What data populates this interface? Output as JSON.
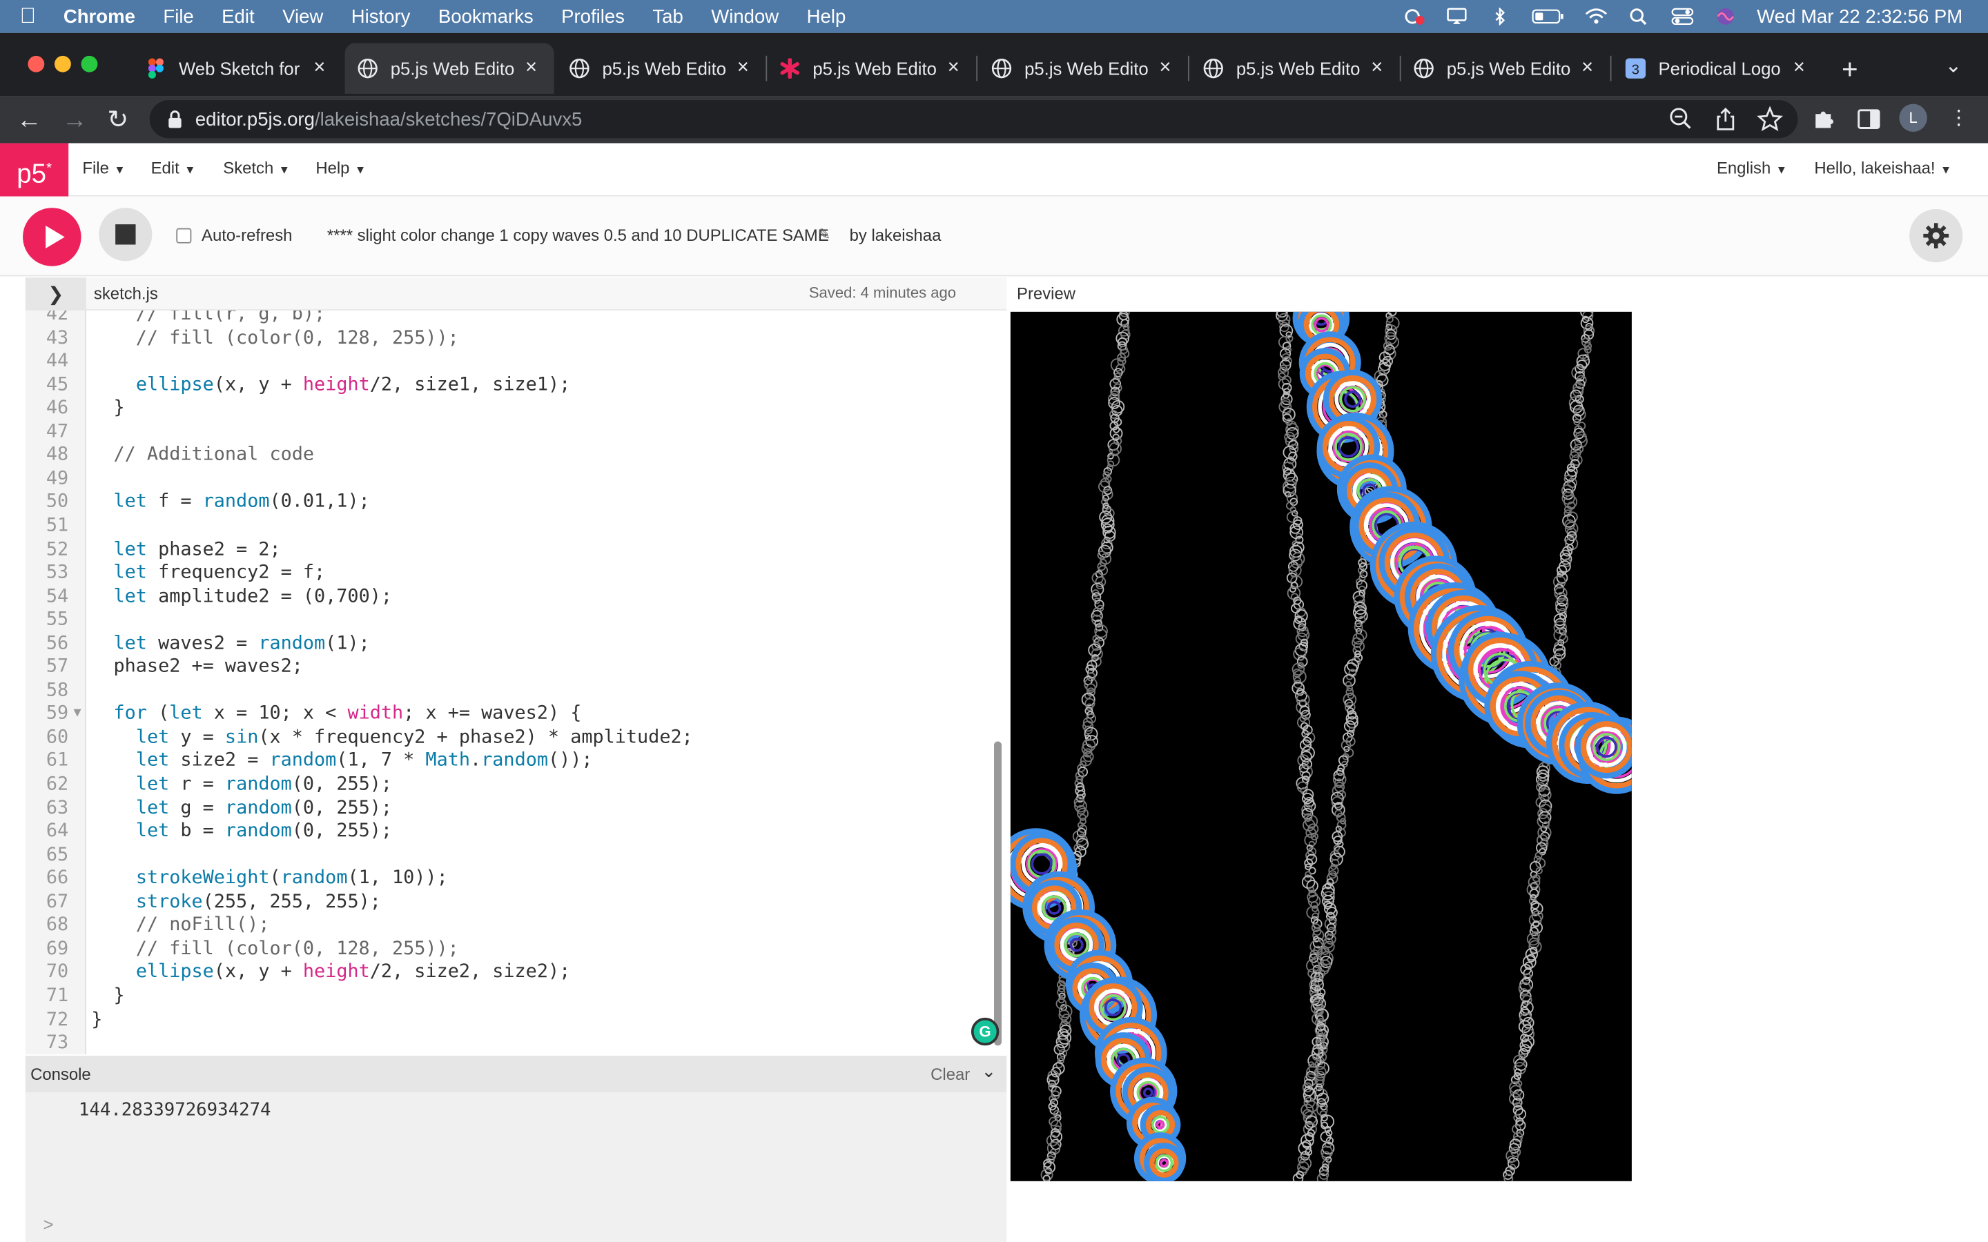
{
  "menubar": {
    "items": [
      "Chrome",
      "File",
      "Edit",
      "View",
      "History",
      "Bookmarks",
      "Profiles",
      "Tab",
      "Window",
      "Help"
    ],
    "clock": "Wed Mar 22  2:32:56 PM"
  },
  "tabs": [
    {
      "title": "Web Sketch for",
      "icon": "figma-icon"
    },
    {
      "title": "p5.js Web Edito",
      "icon": "globe-icon",
      "active": true
    },
    {
      "title": "p5.js Web Edito",
      "icon": "globe-icon"
    },
    {
      "title": "p5.js Web Edito",
      "icon": "asterisk-icon"
    },
    {
      "title": "p5.js Web Edito",
      "icon": "globe-icon"
    },
    {
      "title": "p5.js Web Edito",
      "icon": "globe-icon"
    },
    {
      "title": "p5.js Web Edito",
      "icon": "globe-icon"
    },
    {
      "title": "Periodical Logo",
      "icon": "number-3-icon"
    }
  ],
  "address": {
    "host": "editor.p5js.org",
    "path": "/lakeishaa/sketches/7QiDAuvx5"
  },
  "profile_initial": "L",
  "nav": {
    "logo": "p5",
    "logo_sup": "*",
    "menus": [
      "File",
      "Edit",
      "Sketch",
      "Help"
    ],
    "language": "English",
    "greeting": "Hello, lakeishaa!"
  },
  "toolbar": {
    "auto_refresh_label": "Auto-refresh",
    "sketch_name": "**** slight color change 1 copy waves 0.5 and 10 DUPLICATE SAME",
    "by_prefix": "by ",
    "author": "lakeishaa"
  },
  "filebar": {
    "filename": "sketch.js",
    "saved": "Saved: 4 minutes ago",
    "preview_label": "Preview"
  },
  "code_lines": [
    {
      "n": "42",
      "t": "    // fill(r, g, b);"
    },
    {
      "n": "43",
      "t": "    // fill (color(0, 128, 255));"
    },
    {
      "n": "44",
      "t": ""
    },
    {
      "n": "45",
      "t": "    ellipse(x, y + height/2, size1, size1);"
    },
    {
      "n": "46",
      "t": "  }"
    },
    {
      "n": "47",
      "t": ""
    },
    {
      "n": "48",
      "t": "  // Additional code"
    },
    {
      "n": "49",
      "t": ""
    },
    {
      "n": "50",
      "t": "  let f = random(0.01,1);"
    },
    {
      "n": "51",
      "t": ""
    },
    {
      "n": "52",
      "t": "  let phase2 = 2;"
    },
    {
      "n": "53",
      "t": "  let frequency2 = f;"
    },
    {
      "n": "54",
      "t": "  let amplitude2 = (0,700);"
    },
    {
      "n": "55",
      "t": ""
    },
    {
      "n": "56",
      "t": "  let waves2 = random(1);"
    },
    {
      "n": "57",
      "t": "  phase2 += waves2;"
    },
    {
      "n": "58",
      "t": ""
    },
    {
      "n": "59",
      "t": "  for (let x = 10; x < width; x += waves2) {"
    },
    {
      "n": "60",
      "t": "    let y = sin(x * frequency2 + phase2) * amplitude2;"
    },
    {
      "n": "61",
      "t": "    let size2 = random(1, 7 * Math.random());"
    },
    {
      "n": "62",
      "t": "    let r = random(0, 255);"
    },
    {
      "n": "63",
      "t": "    let g = random(0, 255);"
    },
    {
      "n": "64",
      "t": "    let b = random(0, 255);"
    },
    {
      "n": "65",
      "t": ""
    },
    {
      "n": "66",
      "t": "    strokeWeight(random(1, 10));"
    },
    {
      "n": "67",
      "t": "    stroke(255, 255, 255);"
    },
    {
      "n": "68",
      "t": "    // noFill();"
    },
    {
      "n": "69",
      "t": "    // fill (color(0, 128, 255));"
    },
    {
      "n": "70",
      "t": "    ellipse(x, y + height/2, size2, size2);"
    },
    {
      "n": "71",
      "t": "  }"
    },
    {
      "n": "72",
      "t": "}"
    },
    {
      "n": "73",
      "t": ""
    }
  ],
  "console": {
    "label": "Console",
    "clear_label": "Clear",
    "output": "144.28339726934274",
    "prompt": ">"
  },
  "grammarly_letter": "G",
  "colors": {
    "accent": "#ed225d",
    "menubar": "#4f79a6",
    "tabstrip": "#202124",
    "toolbar": "#35363a"
  }
}
